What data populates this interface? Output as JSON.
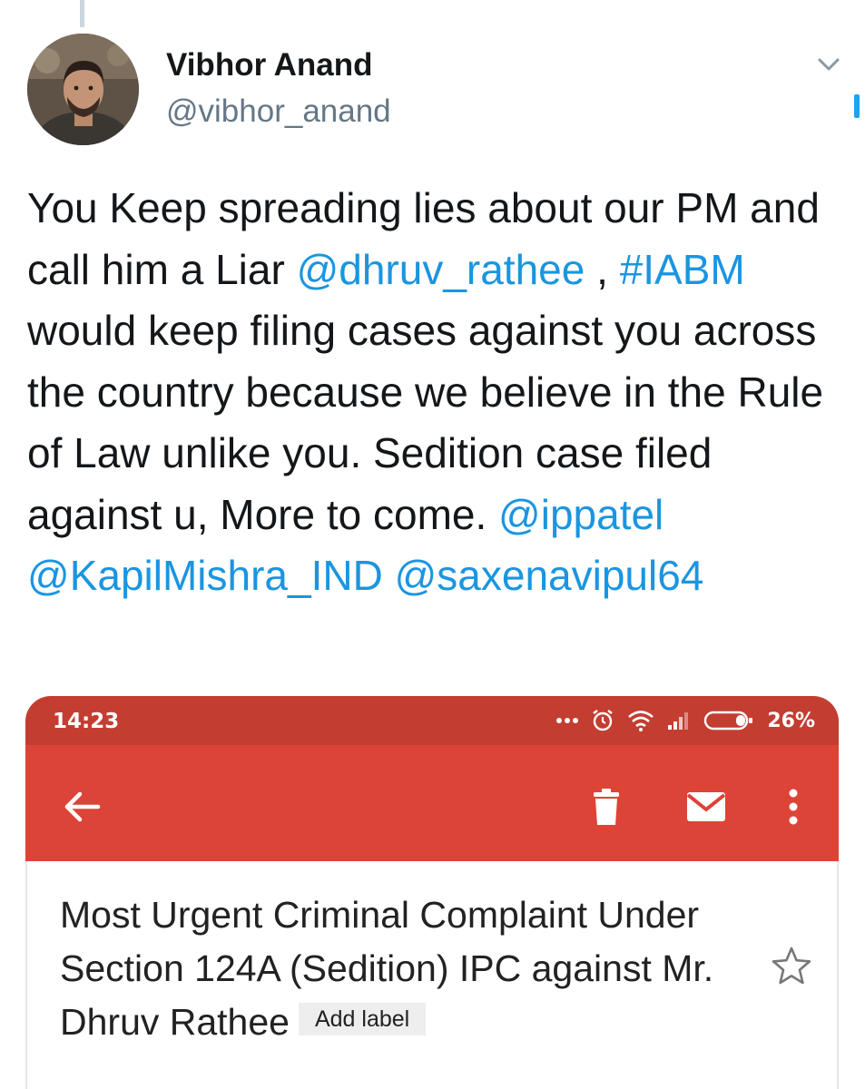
{
  "tweet": {
    "author_name": "Vibhor Anand",
    "author_handle": "@vibhor_anand",
    "text_parts": [
      {
        "text": "You Keep spreading lies about our PM and call him a Liar ",
        "link": false
      },
      {
        "text": "@dhruv_rathee",
        "link": true
      },
      {
        "text": " , ",
        "link": false
      },
      {
        "text": "#IABM",
        "link": true
      },
      {
        "text": " would keep filing cases against you across the country because we believe in the Rule of Law unlike you. Sedition case filed against u, More to come. ",
        "link": false
      },
      {
        "text": "@ippatel",
        "link": true
      },
      {
        "text": " ",
        "link": false
      },
      {
        "text": "@KapilMishra_IND",
        "link": true
      },
      {
        "text": " ",
        "link": false
      },
      {
        "text": "@saxenavipul64",
        "link": true
      }
    ],
    "link_color": "#1b95e0"
  },
  "phone": {
    "status_bar": {
      "time": "14:23",
      "battery": "26%",
      "color": "#c43d31"
    },
    "app_bar": {
      "color": "#db4437",
      "back_icon": "arrow-back-icon",
      "actions": [
        "delete-icon",
        "mail-icon",
        "more-vert-icon"
      ]
    },
    "email": {
      "subject": "Most Urgent Criminal Complaint Under Section 124A (Sedition) IPC against Mr. Dhruv Rathee",
      "label_button": "Add label",
      "star_icon": "star-outline-icon"
    }
  }
}
